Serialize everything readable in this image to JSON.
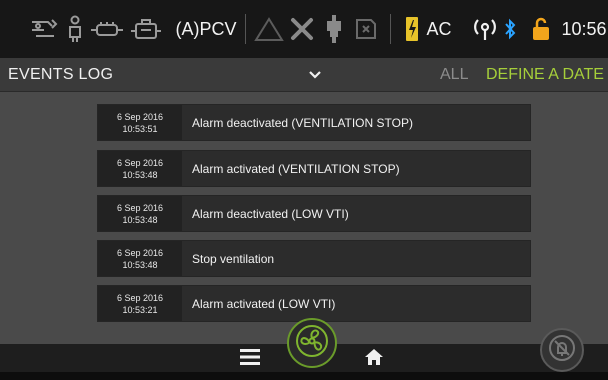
{
  "status": {
    "mode": "(A)PCV",
    "power": "AC",
    "time": "10:56",
    "icons": [
      "circuit-icon",
      "patient-icon",
      "humidifier-icon",
      "oxygen-icon",
      "warning-triangle-icon",
      "tools-icon",
      "connector-icon",
      "valve-icon",
      "battery-charging-icon",
      "wireless-icon",
      "bluetooth-icon",
      "unlock-icon"
    ],
    "colors": {
      "bluetooth": "#2aa3ff",
      "lock": "#f2a51c",
      "battery": "#e7c32a"
    }
  },
  "header": {
    "title": "EVENTS LOG",
    "dropdown_icon": "chevron-down-icon",
    "filter_all": "ALL",
    "filter_date": "DEFINE A DATE",
    "accent": "#a6cf3a"
  },
  "events": [
    {
      "date": "6 Sep 2016",
      "time": "10:53:51",
      "message": "Alarm deactivated (VENTILATION STOP)"
    },
    {
      "date": "6 Sep 2016",
      "time": "10:53:48",
      "message": "Alarm activated (VENTILATION STOP)"
    },
    {
      "date": "6 Sep 2016",
      "time": "10:53:48",
      "message": "Alarm deactivated (LOW VTI)"
    },
    {
      "date": "6 Sep 2016",
      "time": "10:53:48",
      "message": "Stop ventilation"
    },
    {
      "date": "6 Sep 2016",
      "time": "10:53:21",
      "message": "Alarm activated (LOW VTI)"
    }
  ],
  "bottom": {
    "icons": [
      "menu-icon",
      "ventilation-fan-icon",
      "home-icon",
      "alarm-silence-icon"
    ]
  }
}
